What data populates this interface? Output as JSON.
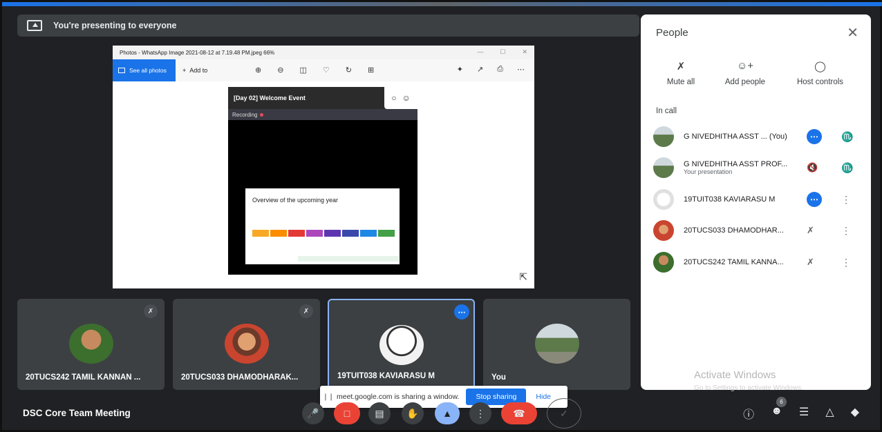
{
  "banner": {
    "text": "You're presenting to everyone"
  },
  "shared_window": {
    "title": "Photos - WhatsApp Image 2021-08-12 at 7.19.48 PM.jpeg   66%",
    "see_all": "See all photos",
    "add_to": "Add to",
    "event_title": "[Day 02] Welcome Event",
    "recording": "Recording",
    "slide_title": "Overview of the upcoming year"
  },
  "tiles": [
    {
      "name": "20TUCS242 TAMIL KANNAN ..."
    },
    {
      "name": "20TUCS033 DHAMODHARAK..."
    },
    {
      "name": "19TUIT038 KAVIARASU M"
    },
    {
      "name": "You"
    }
  ],
  "notice": {
    "text": "meet.google.com is sharing a window.",
    "stop": "Stop sharing",
    "hide": "Hide"
  },
  "meeting_name": "DSC Core Team Meeting",
  "participant_count": "6",
  "panel": {
    "title": "People",
    "actions": {
      "mute_all": "Mute all",
      "add_people": "Add people",
      "host_controls": "Host controls"
    },
    "in_call": "In call",
    "people": [
      {
        "name": "G NIVEDHITHA ASST ... (You)",
        "sub": ""
      },
      {
        "name": "G NIVEDHITHA ASST PROF...",
        "sub": "Your presentation"
      },
      {
        "name": "19TUIT038 KAVIARASU M",
        "sub": ""
      },
      {
        "name": "20TUCS033 DHAMODHAR...",
        "sub": ""
      },
      {
        "name": "20TUCS242 TAMIL KANNA...",
        "sub": ""
      }
    ]
  },
  "watermark": {
    "line1": "Activate Windows",
    "line2": "Go to Settings to activate Windows."
  },
  "colors": {
    "accent": "#1a73e8",
    "danger": "#ea4335",
    "background": "#202124",
    "tile": "#3c4043"
  }
}
